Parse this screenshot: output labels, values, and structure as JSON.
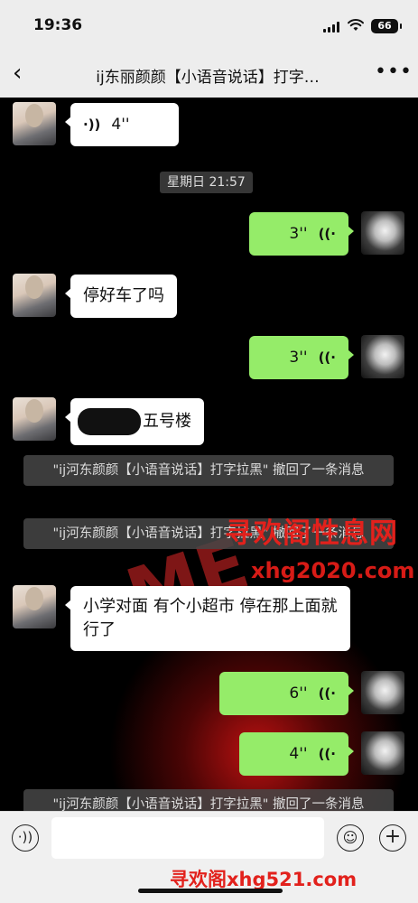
{
  "status_bar": {
    "time": "19:36",
    "battery": "66"
  },
  "header": {
    "back_icon": "chevron-left-icon",
    "title": "ij东丽颜颜【小语音说话】打字…",
    "more_icon": "ellipsis-icon"
  },
  "messages": {
    "m1_duration": "4''",
    "time_divider": "星期日 21:57",
    "m2_duration": "3''",
    "m3_text": "停好车了吗",
    "m4_duration": "3''",
    "m5_text": "五号楼",
    "recall_1": "\"ij河东颜颜【小语音说话】打字拉黑\" 撤回了一条消息",
    "recall_2": "\"ij河东颜颜【小语音说话】打字拉黑\" 撤回了一条消息",
    "m6_text": "小学对面 有个小超市  停在那上面就行了",
    "m7_duration": "6''",
    "m8_duration": "4''",
    "recall_3": "\"ij河东颜颜【小语音说话】打字拉黑\" 撤回了一条消息"
  },
  "watermark": {
    "chinese": "寻欢阁性息网",
    "url": "xhg2020.com",
    "bottom": "寻欢阁xhg521.com",
    "background_text": "ME"
  },
  "input_bar": {
    "voice_icon": "voice-mode-icon",
    "emoji_icon": "emoji-icon",
    "plus_icon": "plus-icon"
  },
  "colors": {
    "chat_bg": "#000000",
    "outgoing_bubble": "#95ec69",
    "incoming_bubble": "#ffffff",
    "watermark_red": "#e2211c"
  }
}
